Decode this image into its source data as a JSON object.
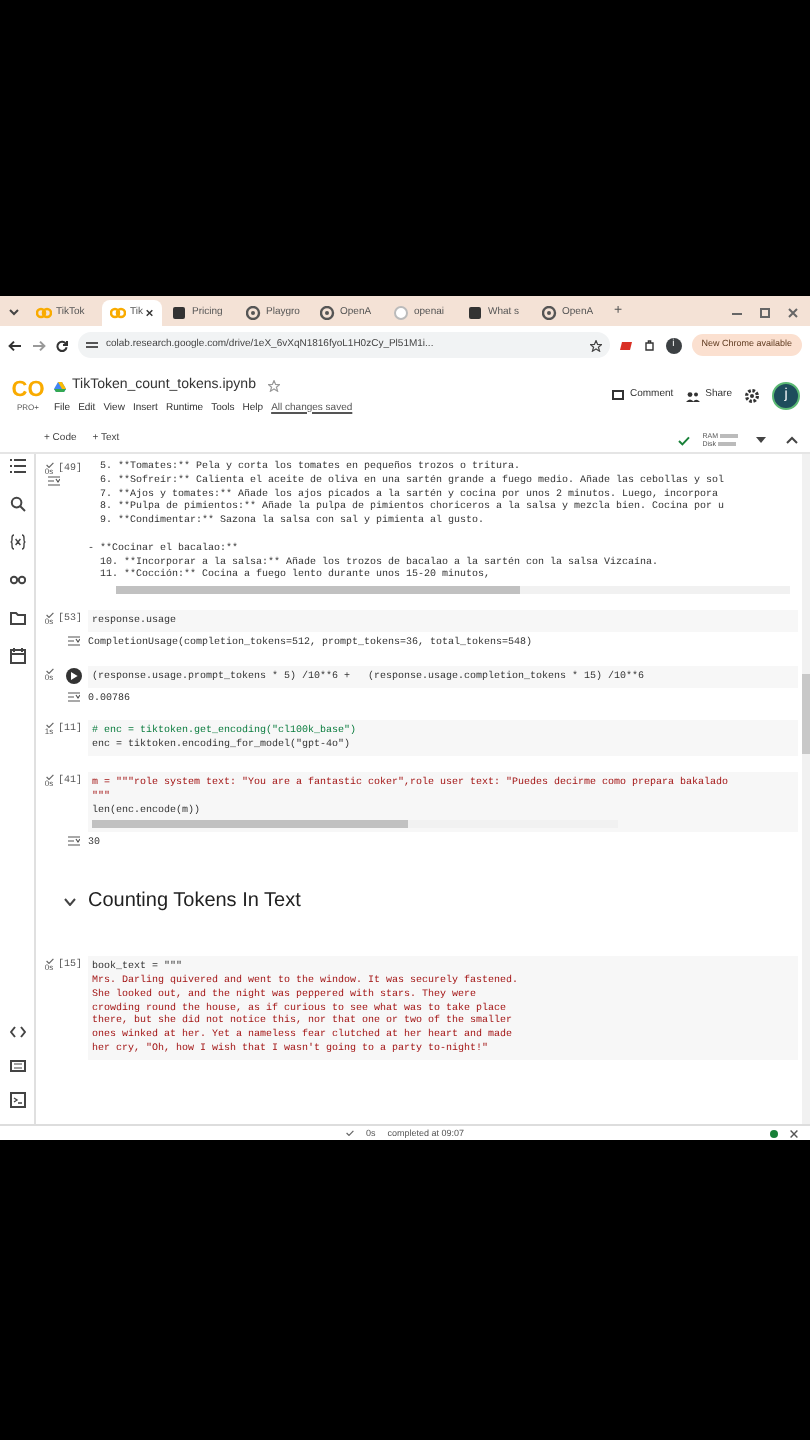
{
  "browser": {
    "tabs": [
      {
        "label": "TikTok",
        "selected": false
      },
      {
        "label": "Tik",
        "selected": true
      },
      {
        "label": "Pricing",
        "selected": false
      },
      {
        "label": "Playgro",
        "selected": false
      },
      {
        "label": "OpenA",
        "selected": false
      },
      {
        "label": "openai",
        "selected": false
      },
      {
        "label": "What s",
        "selected": false
      },
      {
        "label": "OpenA",
        "selected": false
      }
    ],
    "new_tab": "+",
    "address": "colab.research.google.com/drive/1eX_6vXqN1816fyoL1H0zCy_Pl51M1i...",
    "profile": "i",
    "update": "New Chrome available"
  },
  "colab": {
    "logo": "CO",
    "plan": "PRO+",
    "title": "TikToken_count_tokens.ipynb",
    "menu": [
      "File",
      "Edit",
      "View",
      "Insert",
      "Runtime",
      "Tools",
      "Help"
    ],
    "save_status": "All changes saved",
    "comment": "Comment",
    "share": "Share",
    "avatar": "j",
    "toolbar": [
      "+ Code",
      "+ Text"
    ],
    "ram": "RAM",
    "disk": "Disk"
  },
  "cells": [
    {
      "kind": "output_only",
      "time": "0s",
      "count": "[49]",
      "output_blocks": [
        [
          "  5. **Tomates:** Pela y corta los tomates en pequeños trozos o tritura.",
          "  6. **Sofreír:** Calienta el aceite de oliva en una sartén grande a fuego medio. Añade las cebollas y sol",
          "  7. **Ajos y tomates:** Añade los ajos picados a la sartén y cocina por unos 2 minutos. Luego, incorpora",
          "  8. **Pulpa de pimientos:** Añade la pulpa de pimientos choriceros a la salsa y mezcla bien. Cocina por u",
          "  9. **Condimentar:** Sazona la salsa con sal y pimienta al gusto."
        ],
        [
          "- **Cocinar el bacalao:**",
          "  10. **Incorporar a la salsa:** Añade los trozos de bacalao a la sartén con la salsa Vizcaína.",
          "  11. **Cocción:** Cocina a fuego lento durante unos 15-20 minutos,"
        ]
      ],
      "scrollbar": true
    },
    {
      "kind": "code",
      "time": "0s",
      "count": "[53]",
      "lines": [
        {
          "text": "response.usage",
          "kind": "code"
        }
      ],
      "output": [
        "CompletionUsage(completion_tokens=512, prompt_tokens=36, total_tokens=548)"
      ]
    },
    {
      "kind": "code",
      "time": "0s",
      "running": true,
      "lines": [
        {
          "text": "(response.usage.prompt_tokens * 5) /10**6 +   (response.usage.completion_tokens * 15) /10**6",
          "kind": "code"
        }
      ],
      "output": [
        "0.00786"
      ]
    },
    {
      "kind": "code",
      "time": "1s",
      "count": "[11]",
      "lines": [
        {
          "text": "# enc = tiktoken.get_encoding(\"cl100k_base\")",
          "kind": "comment"
        },
        {
          "text": "enc = tiktoken.encoding_for_model(\"gpt-4o\")",
          "kind": "code"
        }
      ]
    },
    {
      "kind": "code",
      "time": "0s",
      "count": "[41]",
      "lines": [
        {
          "text": "m = \"\"\"role system text: \"You are a fantastic coker\",role user text: \"Puedes decirme como prepara bakalado",
          "kind": "string"
        },
        {
          "text": "\"\"\"",
          "kind": "string"
        },
        {
          "text": "len(enc.encode(m))",
          "kind": "code"
        }
      ],
      "scrollbar": true,
      "output": [
        "30"
      ]
    },
    {
      "kind": "heading",
      "text": "Counting Tokens In Text",
      "expanded": true
    },
    {
      "kind": "code",
      "time": "0s",
      "count": "[15]",
      "lines": [
        {
          "text": "book_text = \"\"\"",
          "kind": "code"
        },
        {
          "text": "Mrs. Darling quivered and went to the window. It was securely fastened.",
          "kind": "string"
        },
        {
          "text": "She looked out, and the night was peppered with stars. They were",
          "kind": "string"
        },
        {
          "text": "crowding round the house, as if curious to see what was to take place",
          "kind": "string"
        },
        {
          "text": "there, but she did not notice this, nor that one or two of the smaller",
          "kind": "string"
        },
        {
          "text": "ones winked at her. Yet a nameless fear clutched at her heart and made",
          "kind": "string"
        },
        {
          "text": "her cry, \"Oh, how I wish that I wasn't going to a party to-night!\"",
          "kind": "string"
        }
      ]
    }
  ],
  "status_bar": {
    "time": "0s",
    "completed": "completed at 09:07"
  }
}
